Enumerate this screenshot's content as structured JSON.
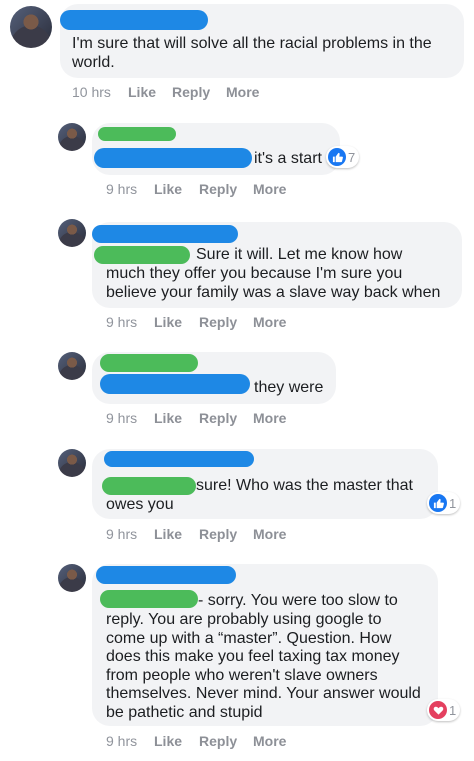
{
  "comments": [
    {
      "text": "I'm sure that will solve all the racial problems in the\nworld.",
      "time": "10 hrs",
      "like": "Like",
      "reply": "Reply",
      "more": "More"
    },
    {
      "text": "it's a start",
      "time": "9 hrs",
      "like": "Like",
      "reply": "Reply",
      "more": "More",
      "reaction_count": "7",
      "reaction_icon": "like-icon"
    },
    {
      "text_line1": "Sure it will. Let me know how",
      "text_rest": "much they offer you because I'm sure you\nbelieve your family was a slave way back when",
      "time": "9 hrs",
      "like": "Like",
      "reply": "Reply",
      "more": "More"
    },
    {
      "text": "they were",
      "time": "9 hrs",
      "like": "Like",
      "reply": "Reply",
      "more": "More"
    },
    {
      "text_line1": "sure! Who was the master that",
      "text_rest": "owes you",
      "time": "9 hrs",
      "like": "Like",
      "reply": "Reply",
      "more": "More",
      "reaction_count": "1",
      "reaction_icon": "like-icon"
    },
    {
      "text_line1": "- sorry. You were too slow to",
      "text_rest": "reply. You are probably using google to\ncome up with a “master”. Question. How\ndoes this make you feel taxing tax money\nfrom people who weren't slave owners\nthemselves. Never mind. Your answer would\nbe pathetic and stupid",
      "time": "9 hrs",
      "like": "Like",
      "reply": "Reply",
      "more": "More",
      "reaction_count": "1",
      "reaction_icon": "love-icon"
    }
  ],
  "colors": {
    "bubble": "#f2f3f5",
    "redaction_blue": "#1e88e5",
    "redaction_green": "#4cbb5a",
    "like_blue": "#1877f2",
    "love_red": "#e4405f",
    "meta_gray": "#90949c"
  }
}
